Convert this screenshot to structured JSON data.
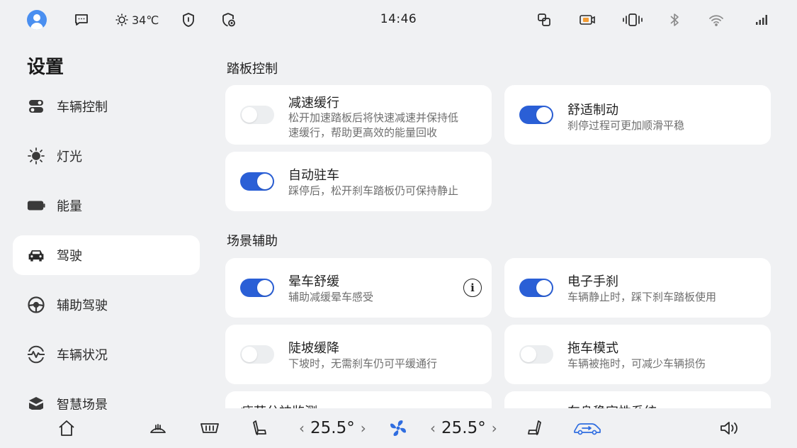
{
  "status_bar": {
    "temperature": "34℃",
    "clock": "14:46",
    "icons": [
      "avatar",
      "chat-icon",
      "sun-icon",
      "shield-icon",
      "privacy-icon",
      "phone-mirror-icon",
      "dashcam-icon",
      "vibration-icon",
      "bluetooth-icon",
      "wifi-icon",
      "signal-icon"
    ]
  },
  "page": {
    "title": "设置"
  },
  "sidebar": {
    "items": [
      {
        "label": "车辆控制",
        "icon": "toggle-icon",
        "active": false
      },
      {
        "label": "灯光",
        "icon": "light-icon",
        "active": false
      },
      {
        "label": "能量",
        "icon": "battery-icon",
        "active": false
      },
      {
        "label": "驾驶",
        "icon": "car-icon",
        "active": true
      },
      {
        "label": "辅助驾驶",
        "icon": "steering-wheel-icon",
        "active": false
      },
      {
        "label": "车辆状况",
        "icon": "vehicle-status-icon",
        "active": false
      },
      {
        "label": "智慧场景",
        "icon": "smart-scene-icon",
        "active": false
      }
    ]
  },
  "sections": [
    {
      "title": "踏板控制"
    },
    {
      "title": "场景辅助"
    }
  ],
  "cards": [
    {
      "title": "减速缓行",
      "desc_lines": [
        "松开加速踏板后将快速减速并保持低",
        "速缓行，帮助更高效的能量回收"
      ],
      "on": false
    },
    {
      "title": "舒适制动",
      "desc_lines": [
        "刹停过程可更加顺滑平稳"
      ],
      "on": true
    },
    {
      "title": "自动驻车",
      "desc_lines": [
        "踩停后，松开刹车踏板仍可保持静止"
      ],
      "on": true
    },
    {
      "title": "晕车舒缓",
      "desc_lines": [
        "辅助减缓晕车感受"
      ],
      "on": true,
      "info": "i"
    },
    {
      "title": "电子手刹",
      "desc_lines": [
        "车辆静止时，踩下刹车踏板使用"
      ],
      "on": true
    },
    {
      "title": "陡坡缓降",
      "desc_lines": [
        "下坡时，无需刹车仍可平缓通行"
      ],
      "on": false
    },
    {
      "title": "拖车模式",
      "desc_lines": [
        "车辆被拖时，可减少车辆损伤"
      ],
      "on": false
    },
    {
      "title": "疲劳分神监测",
      "desc_lines": [],
      "on": false
    },
    {
      "title": "车身稳定性系统",
      "desc_lines": [],
      "on": false
    }
  ],
  "bottom_bar": {
    "left_temp": "25.5°",
    "right_temp": "25.5°",
    "chevron_left": "‹",
    "chevron_right": "›",
    "icons": [
      "home-icon",
      "defrost-front-icon",
      "defrost-rear-icon",
      "seat-heat-left-icon",
      "fan-icon",
      "seat-heat-right-icon",
      "air-circulation-icon",
      "volume-icon"
    ]
  },
  "colors": {
    "accent": "#2a5fd6",
    "fan": "#2f6de0",
    "background": "#f0f1f3",
    "card": "#ffffff"
  }
}
